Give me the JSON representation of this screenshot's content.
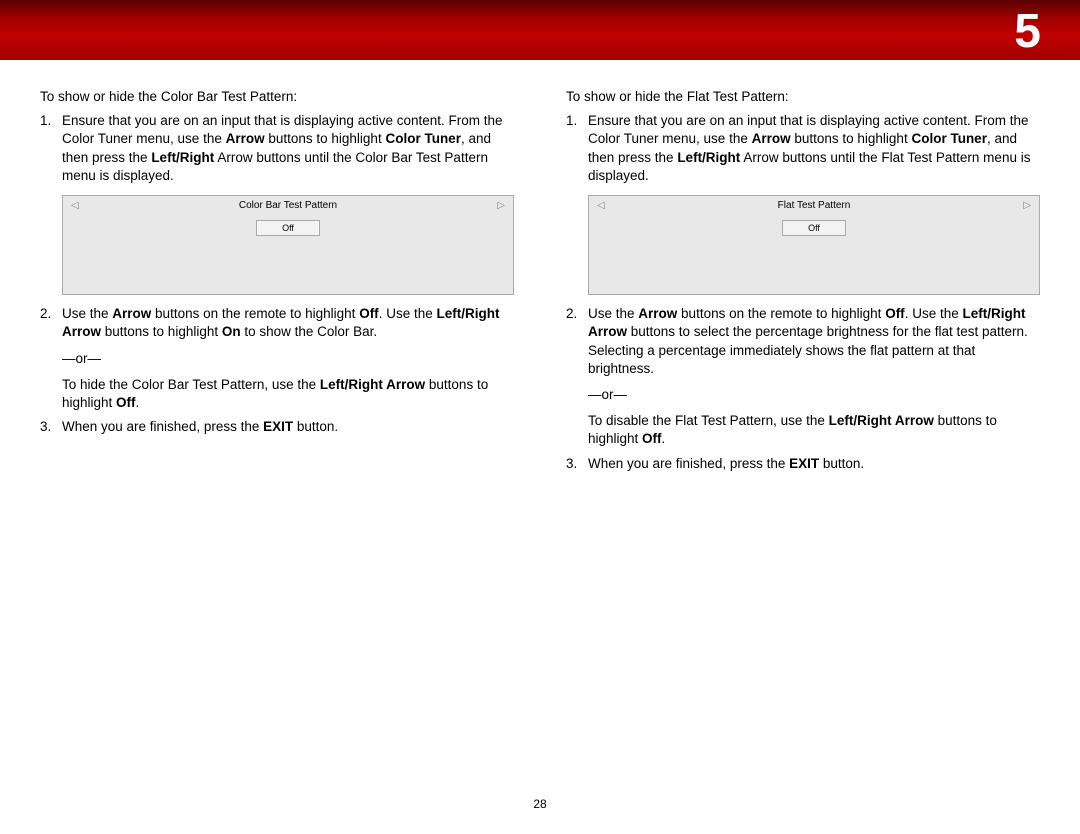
{
  "chapter": "5",
  "page_number": "28",
  "left": {
    "intro": "To show or hide the Color Bar Test Pattern:",
    "step1_a": "Ensure that you are on an input that is displaying active content. From the Color Tuner menu, use the ",
    "step1_b_bold": "Arrow",
    "step1_c": " buttons to highlight ",
    "step1_d_bold": "Color Tuner",
    "step1_e": ", and then press the ",
    "step1_f_bold": "Left/Right",
    "step1_g": " Arrow buttons until the Color Bar Test Pattern menu is displayed.",
    "menu_title": "Color Bar Test Pattern",
    "menu_value": "Off",
    "step2_a": "Use the ",
    "step2_b_bold": "Arrow",
    "step2_c": " buttons on the remote to highlight ",
    "step2_d_bold": "Off",
    "step2_e": ". Use the ",
    "step2_f_bold": "Left/Right Arrow",
    "step2_g": " buttons to highlight ",
    "step2_h_bold": "On",
    "step2_i": " to show the Color Bar.",
    "or": "—or—",
    "step2_alt_a": "To hide the Color Bar Test Pattern, use the ",
    "step2_alt_b_bold": "Left/Right Arrow",
    "step2_alt_c": " buttons to highlight ",
    "step2_alt_d_bold": "Off",
    "step2_alt_e": ".",
    "step3_a": "When you are finished, press the ",
    "step3_b_bold": "EXIT",
    "step3_c": " button."
  },
  "right": {
    "intro": "To show or hide the Flat Test Pattern:",
    "step1_a": "Ensure that you are on an input that is displaying active content. From the Color Tuner menu, use the ",
    "step1_b_bold": "Arrow",
    "step1_c": " buttons to highlight ",
    "step1_d_bold": "Color Tuner",
    "step1_e": ", and then press the ",
    "step1_f_bold": "Left/Right",
    "step1_g": " Arrow buttons until the Flat Test Pattern menu is displayed.",
    "menu_title": "Flat Test Pattern",
    "menu_value": "Off",
    "step2_a": "Use the ",
    "step2_b_bold": "Arrow",
    "step2_c": " buttons on the remote to highlight ",
    "step2_d_bold": "Off",
    "step2_e": ". Use the ",
    "step2_f_bold": "Left/Right Arrow",
    "step2_g": " buttons to select the percentage brightness for the flat test pattern. Selecting a percentage immediately shows the flat pattern at that brightness.",
    "or": "—or—",
    "step2_alt_a": "To disable the Flat Test Pattern, use the ",
    "step2_alt_b_bold": "Left/Right Arrow",
    "step2_alt_c": " buttons to highlight ",
    "step2_alt_d_bold": "Off",
    "step2_alt_e": ".",
    "step3_a": "When you are finished, press the ",
    "step3_b_bold": "EXIT",
    "step3_c": " button."
  }
}
